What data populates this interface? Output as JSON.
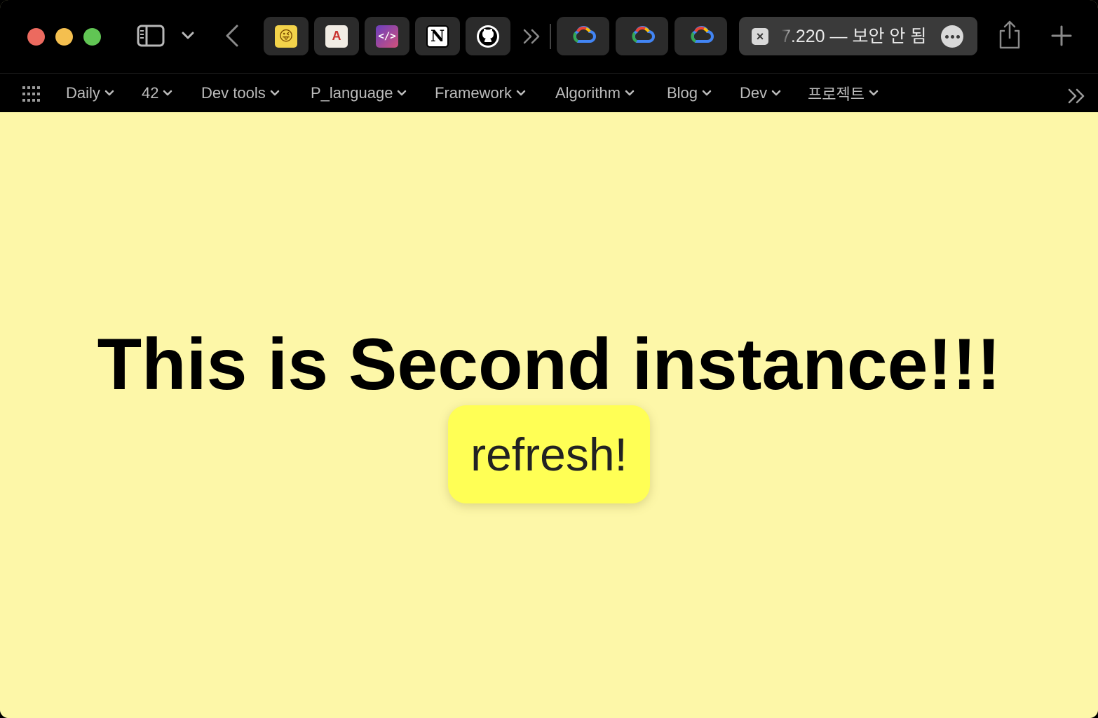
{
  "browser": {
    "active_tab": {
      "title": "7.220 — 보안 안 됨"
    },
    "pinned_tabs": [
      {
        "icon": "emoji-favicon-icon"
      },
      {
        "icon": "tower-favicon-icon",
        "glyph": "A"
      },
      {
        "icon": "code-favicon-icon",
        "glyph": "</>"
      },
      {
        "icon": "notion-favicon-icon",
        "glyph": "N"
      },
      {
        "icon": "github-favicon-icon"
      }
    ],
    "cloud_tabs": [
      {
        "icon": "google-cloud-icon"
      },
      {
        "icon": "google-cloud-icon"
      },
      {
        "icon": "google-cloud-icon"
      }
    ]
  },
  "bookmarks": [
    {
      "label": "Daily"
    },
    {
      "label": "42"
    },
    {
      "label": "Dev tools"
    },
    {
      "label": "P_language"
    },
    {
      "label": "Framework"
    },
    {
      "label": "Algorithm"
    },
    {
      "label": "Blog"
    },
    {
      "label": "Dev"
    },
    {
      "label": "프로젝트"
    }
  ],
  "page": {
    "headline": "This is Second instance!!!",
    "refresh_label": "refresh!",
    "background_color": "#fdf7a8",
    "button_color": "#ffff55"
  }
}
